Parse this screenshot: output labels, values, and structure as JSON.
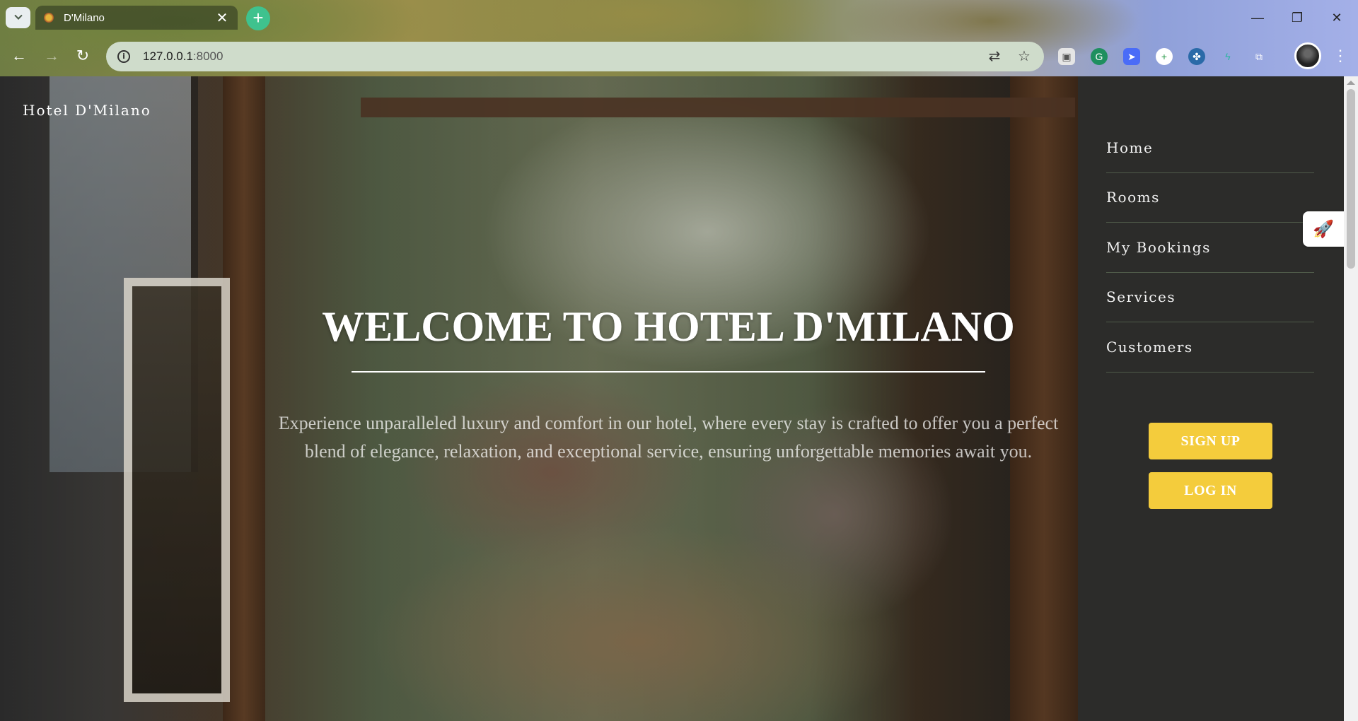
{
  "browser": {
    "tab_title": "D'Milano",
    "url_host": "127.0.0.1",
    "url_port": ":8000",
    "colors": {
      "new_tab_button": "#3fc28e",
      "omnibox": "#cfdccb"
    }
  },
  "site": {
    "logo": "Hotel D'Milano",
    "hero": {
      "title": "WELCOME TO HOTEL D'MILANO",
      "text": "Experience unparalleled luxury and comfort in our hotel, where every stay is crafted to offer you a perfect blend of elegance, relaxation, and exceptional service, ensuring unforgettable memories await you."
    },
    "nav": {
      "items": [
        {
          "label": "Home"
        },
        {
          "label": "Rooms"
        },
        {
          "label": "My Bookings"
        },
        {
          "label": "Services"
        },
        {
          "label": "Customers"
        }
      ],
      "signup": "SIGN UP",
      "login": "LOG IN"
    },
    "colors": {
      "sidebar": "#2c2c2a",
      "button": "#f4cc3c"
    }
  }
}
